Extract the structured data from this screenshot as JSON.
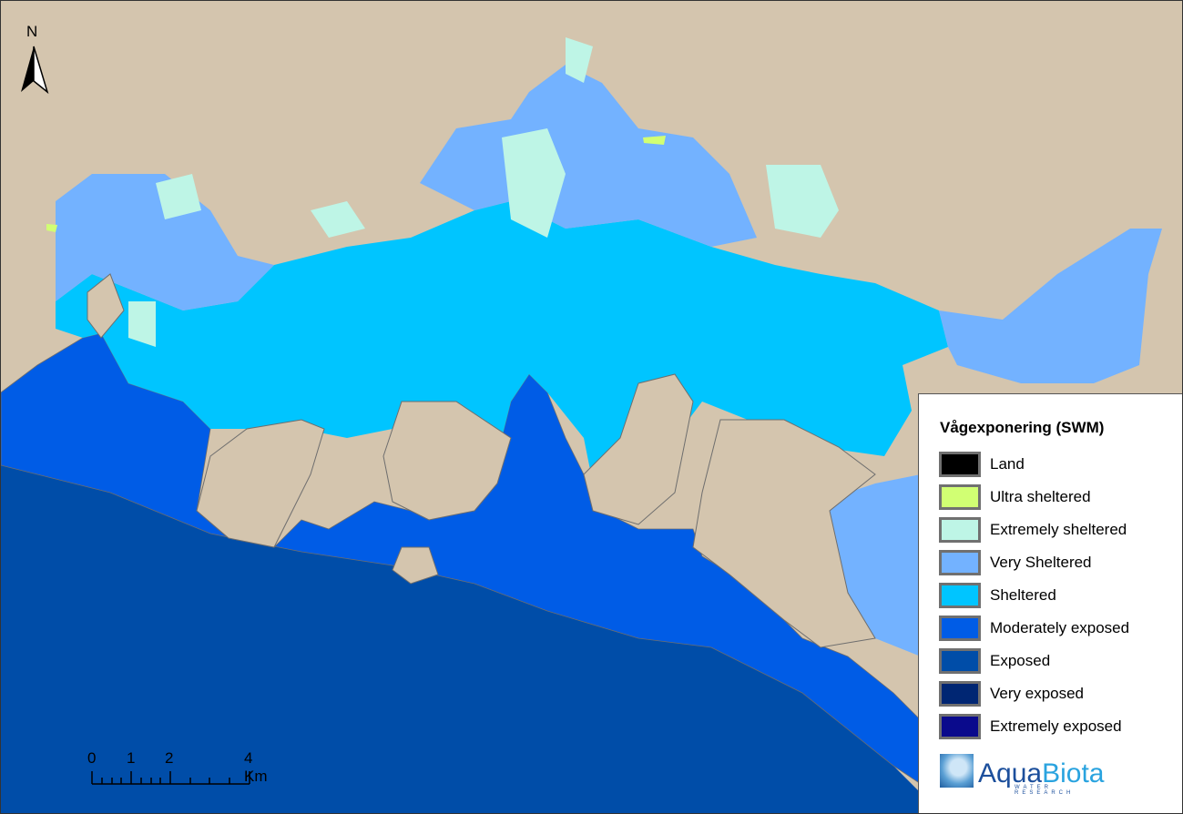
{
  "north_arrow": {
    "label": "N"
  },
  "scale_bar": {
    "ticks": [
      "0",
      "1",
      "2",
      "4 Km"
    ]
  },
  "legend": {
    "title": "Vågexponering (SWM)",
    "items": [
      {
        "label": "Land",
        "color": "#000000"
      },
      {
        "label": "Ultra sheltered",
        "color": "#d1ff73"
      },
      {
        "label": "Extremely sheltered",
        "color": "#bef5e6"
      },
      {
        "label": "Very Sheltered",
        "color": "#73b2ff"
      },
      {
        "label": "Sheltered",
        "color": "#00c5ff"
      },
      {
        "label": "Moderately exposed",
        "color": "#005ce6"
      },
      {
        "label": "Exposed",
        "color": "#004da8"
      },
      {
        "label": "Very exposed",
        "color": "#002673"
      },
      {
        "label": "Extremely exposed",
        "color": "#0a0a8c"
      }
    ]
  },
  "map_colors": {
    "land_background": "#d4c5ae",
    "coastline": "#6e6e6e"
  },
  "logo": {
    "name": "AquaBiota",
    "tagline": "WATER RESEARCH"
  }
}
